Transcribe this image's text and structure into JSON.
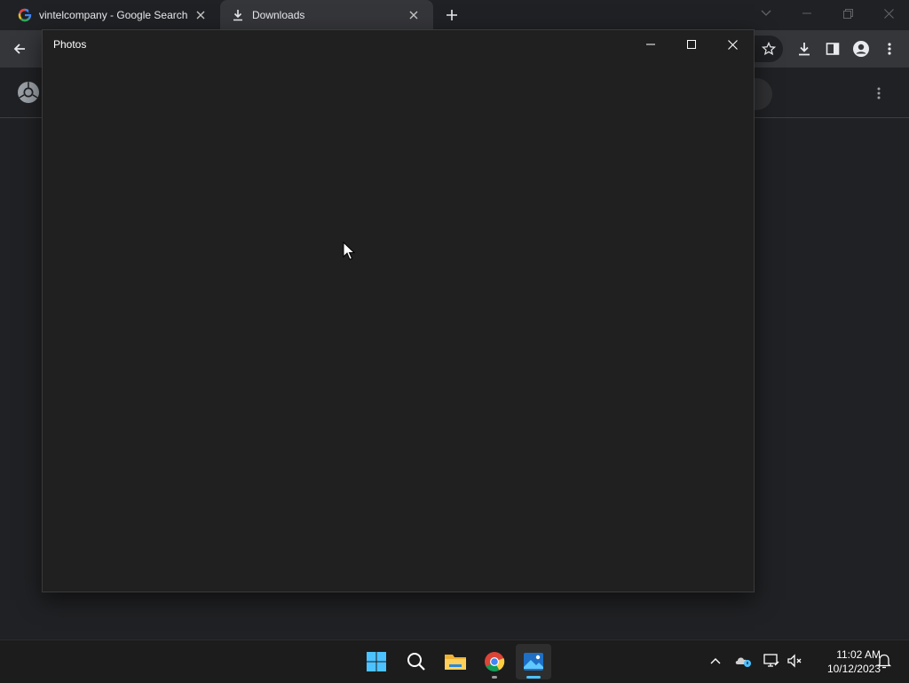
{
  "browser": {
    "tabs": [
      {
        "title": "vintelcompany - Google Search",
        "icon": "google-g-icon"
      },
      {
        "title": "Downloads",
        "icon": "download-icon"
      }
    ]
  },
  "photos_window": {
    "title": "Photos"
  },
  "taskbar": {
    "apps": [
      "start-icon",
      "search-icon",
      "file-explorer-icon",
      "chrome-icon",
      "photos-icon"
    ],
    "clock": {
      "time": "11:02 AM",
      "date": "10/12/2023"
    }
  },
  "colors": {
    "page_bg": "#202124",
    "toolbar_bg": "#35363a",
    "photos_bg": "#202020",
    "taskbar_bg": "#1c1c1c",
    "accent": "#4cc2ff"
  }
}
